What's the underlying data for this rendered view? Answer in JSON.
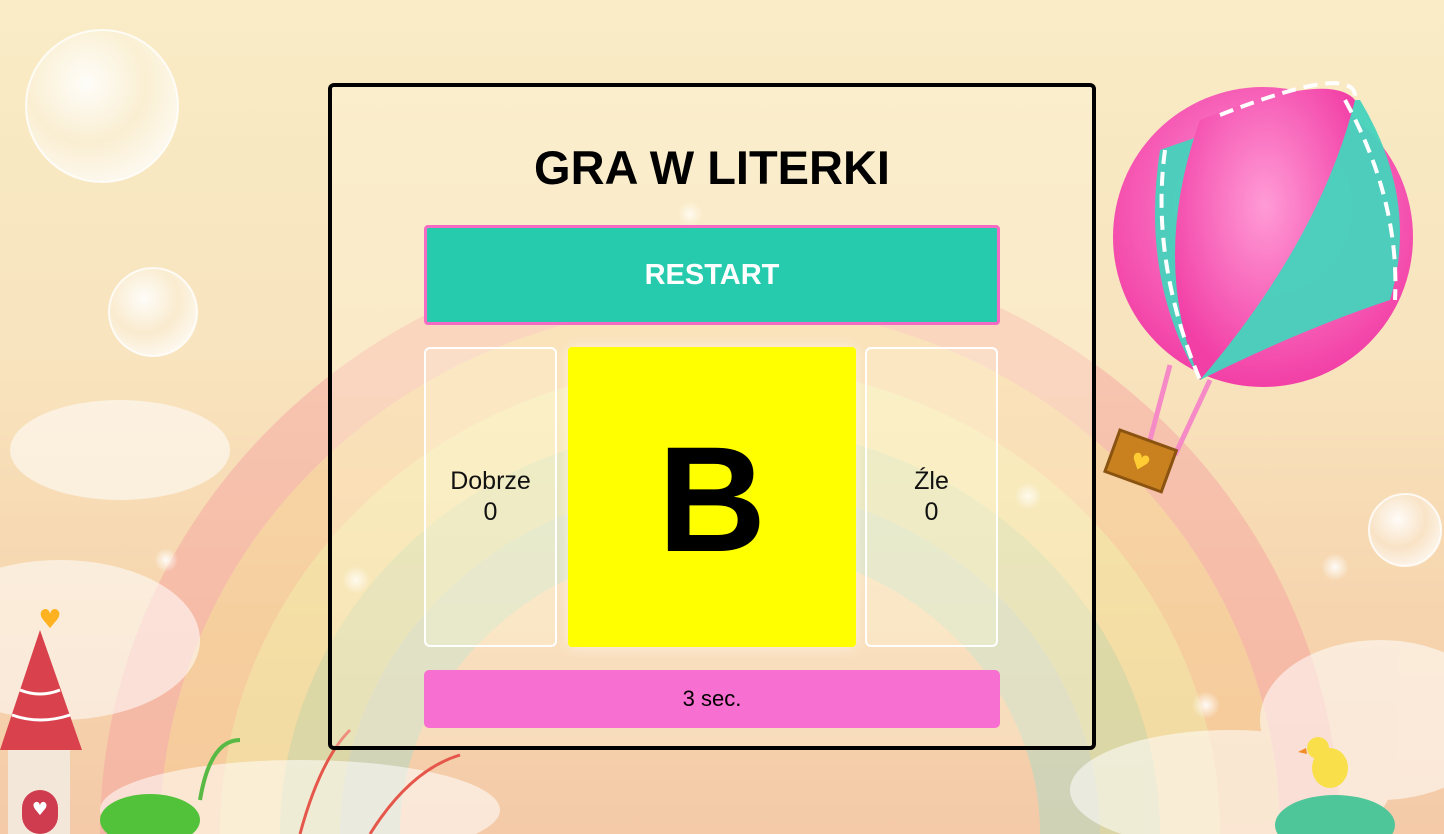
{
  "game": {
    "title": "GRA W LITERKI",
    "restart_label": "RESTART",
    "current_letter": "B",
    "good": {
      "label": "Dobrze",
      "count": "0"
    },
    "bad": {
      "label": "Źle",
      "count": "0"
    },
    "timer": "3 sec."
  },
  "colors": {
    "restart_bg": "#26cbad",
    "restart_border": "#f56bc4",
    "letter_bg": "#ffff00",
    "timer_bg": "#f76fd0",
    "board_border": "#000000"
  },
  "icons": [
    "bubble-icon",
    "hot-air-balloon-icon",
    "rainbow-icon",
    "castle-tower-icon",
    "bird-icon"
  ]
}
